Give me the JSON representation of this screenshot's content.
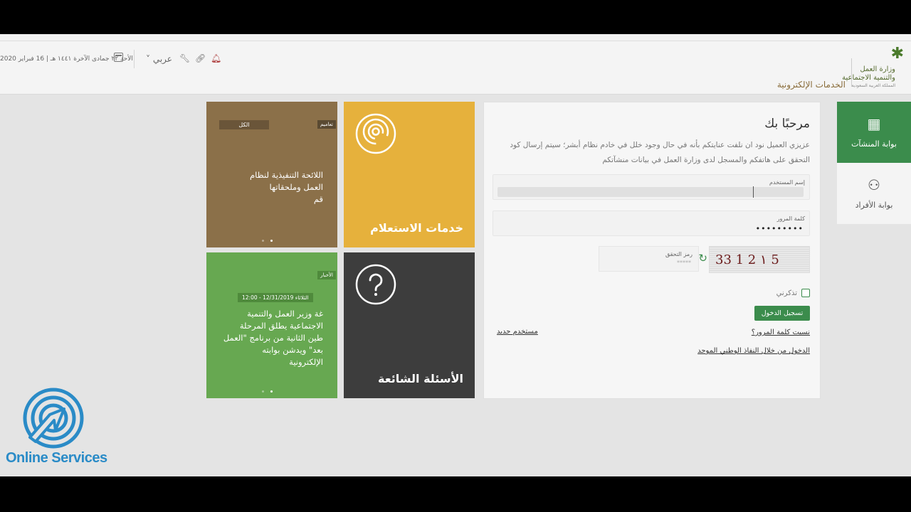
{
  "header": {
    "org_name_line1": "وزارة العمل",
    "org_name_line2": "والتنمية الاجتماعية",
    "org_name_line3": "المملكة العربية السعودية",
    "section_title": "الخدمات الإلكترونية",
    "date_text": "الأحد ٢٢ جمادى الآخرة ١٤٤١ هـ | 16 فبراير 2020",
    "language_label": "عربي"
  },
  "sidebar": {
    "items": [
      {
        "label": "بوابة المنشآت",
        "icon": "building-icon",
        "active": true
      },
      {
        "label": "بوابة الأفراد",
        "icon": "user-gear-icon",
        "active": false
      }
    ]
  },
  "login": {
    "welcome": "مرحبًا بك",
    "notice": "عزيزي العميل نود ان نلفت عنايتكم بأنه في حال وجود خلل في خادم نظام أبشر؛ سيتم إرسال كود التحقق على هاتفكم والمسجل لدى وزارة العمل في بيانات منشآتكم",
    "username_label": "إسم المستخدم",
    "password_label": "كلمة المرور",
    "password_value": "•••••••••",
    "captcha_label": "رمز التحقق",
    "captcha_placeholder": "*****",
    "captcha_text": "33 1 2 ١ 5",
    "remember_label": "تذكرني",
    "login_button": "تسجيل الدخول",
    "forgot_link": "نسيت كلمة المرور؟",
    "new_user_link": "مستخدم جديد",
    "nafath_link": "الدخول من خلال النفاذ الوطني الموحد"
  },
  "tiles": {
    "inquiry": {
      "title": "خدمات الاستعلام",
      "icon": "broadcast-icon"
    },
    "faq": {
      "title": "الأسئلة الشائعة",
      "icon": "question-icon"
    },
    "circulars": {
      "tag": "تعاميم",
      "pill": "الكل",
      "text": [
        "اللائحة التنفيذية لنظام",
        "العمل وملحقاتها",
        "قم"
      ]
    },
    "news": {
      "tag": "الأخبار",
      "date": "الثلاثاء 12/31/2019 - 12:00",
      "text": [
        "غة    وزير العمل والتنمية",
        "الاجتماعية يطلق المرحلة",
        "طين الثانية من برنامج \"العمل",
        "بعد\" ويدشن بوابته",
        "الإلكترونية"
      ]
    }
  },
  "watermark": {
    "text": "Online Services"
  },
  "colors": {
    "green": "#3b8c4c",
    "yellow": "#e6b13c",
    "brown": "#8b7049",
    "dark": "#3d3d3d",
    "light_green": "#67a851",
    "brand_blue": "#2a8bc7"
  }
}
